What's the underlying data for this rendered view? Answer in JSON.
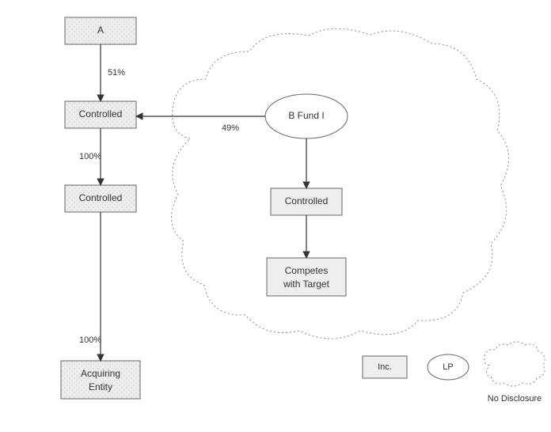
{
  "nodes": {
    "a": "A",
    "controlled1": "Controlled",
    "controlled2": "Controlled",
    "acquiring_l1": "Acquiring",
    "acquiring_l2": "Entity",
    "bfund": "B Fund I",
    "controlled3": "Controlled",
    "competes_l1": "Competes",
    "competes_l2": "with Target"
  },
  "edges": {
    "a_c1": "51%",
    "c1_c2": "100%",
    "c2_acq": "100%",
    "bf_c1": "49%"
  },
  "legend": {
    "inc": "Inc.",
    "lp": "LP",
    "nodisc": "No Disclosure"
  }
}
